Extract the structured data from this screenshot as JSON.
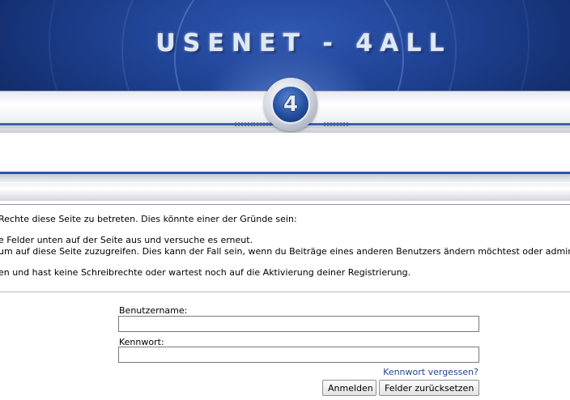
{
  "header": {
    "logo_text": "USENET - 4ALL",
    "emblem_glyph": "4"
  },
  "messages": {
    "line1": "Rechte diese Seite zu betreten. Dies könnte einer der Gründe sein:",
    "line2": "e Felder unten auf der Seite aus und versuche es erneut.",
    "line3": "um auf diese Seite zuzugreifen. Dies kann der Fall sein, wenn du Beiträge eines anderen Benutzers ändern möchtest oder admin",
    "line4": "en und hast keine Schreibrechte oder wartest noch auf die Aktivierung deiner Registrierung."
  },
  "login": {
    "username_label": "Benutzername:",
    "username_value": "",
    "password_label": "Kennwort:",
    "password_value": "",
    "forgot_link": "Kennwort vergessen?",
    "submit_label": "Anmelden",
    "reset_label": "Felder zurücksetzen"
  },
  "colors": {
    "banner_blue": "#1d3f8e",
    "accent_stripe": "#2a52a8",
    "link": "#22498c"
  }
}
